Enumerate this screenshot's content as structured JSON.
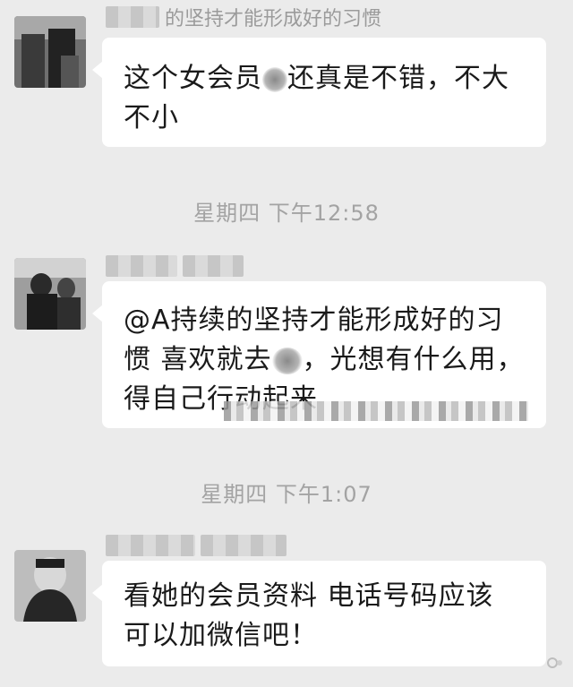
{
  "messages": [
    {
      "sender_visible": "的坚持才能形成好的习惯",
      "text_before": "这个女会员",
      "text_after": "还真是不错，不大不小",
      "timestamp": "星期四 下午12:58"
    },
    {
      "text_before": "@A持续的坚持才能形成好的习惯 喜欢就去",
      "text_after": "，光想有什么用，得自己行动起来",
      "timestamp": "星期四 下午1:07"
    },
    {
      "text_lines": [
        "看她的会员资料 电话号码应该",
        "可以加微信吧！"
      ]
    }
  ],
  "icons": {
    "avatar_1": "avatar-photo-icon",
    "avatar_2": "avatar-photo-icon",
    "avatar_3": "avatar-photo-icon"
  },
  "colors": {
    "background": "#ebebeb",
    "bubble": "#ffffff",
    "timestamp_text": "#a3a3a3"
  }
}
